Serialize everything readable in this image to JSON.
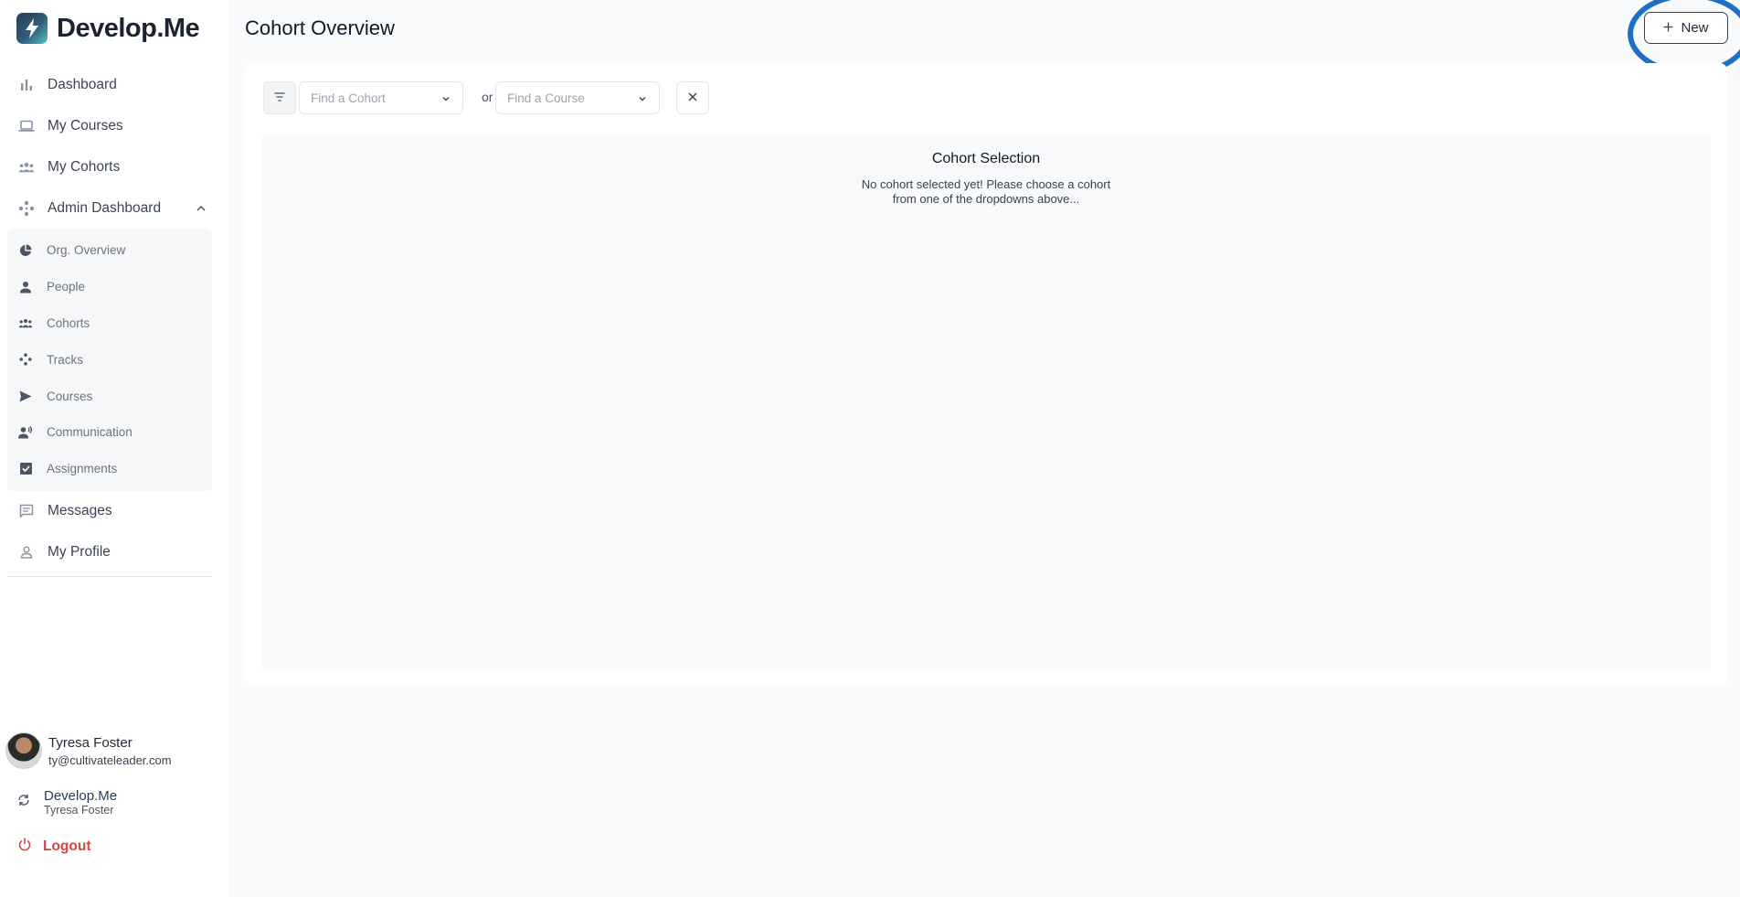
{
  "app": {
    "brand": "Develop.Me"
  },
  "sidebar": {
    "items": [
      {
        "label": "Dashboard",
        "icon": "bar-chart-icon"
      },
      {
        "label": "My Courses",
        "icon": "laptop-icon"
      },
      {
        "label": "My Cohorts",
        "icon": "group-icon"
      },
      {
        "label": "Admin Dashboard",
        "icon": "hub-icon",
        "expanded": true
      }
    ],
    "admin_items": [
      {
        "label": "Org. Overview",
        "icon": "pie-chart-icon"
      },
      {
        "label": "People",
        "icon": "person-icon"
      },
      {
        "label": "Cohorts",
        "icon": "group-icon"
      },
      {
        "label": "Tracks",
        "icon": "tracks-icon"
      },
      {
        "label": "Courses",
        "icon": "send-icon"
      },
      {
        "label": "Communication",
        "icon": "speaker-person-icon"
      },
      {
        "label": "Assignments",
        "icon": "checkbox-icon"
      }
    ],
    "bottom_items": [
      {
        "label": "Messages",
        "icon": "chat-icon"
      },
      {
        "label": "My Profile",
        "icon": "person-outline-icon"
      }
    ]
  },
  "user": {
    "name": "Tyresa Foster",
    "email": "ty@cultivateleader.com"
  },
  "org": {
    "name": "Develop.Me",
    "member": "Tyresa Foster"
  },
  "logout_label": "Logout",
  "page": {
    "title": "Cohort Overview",
    "new_button": "New"
  },
  "filters": {
    "cohort_placeholder": "Find a Cohort",
    "or_text": "or",
    "course_placeholder": "Find a Course"
  },
  "panel": {
    "title": "Cohort Selection",
    "message": "No cohort selected yet! Please choose a cohort from one of the dropdowns above..."
  },
  "colors": {
    "accent": "#2a3c55",
    "teal": "#54c2c6",
    "highlight": "#1f6fc4",
    "logout": "#d64545"
  }
}
